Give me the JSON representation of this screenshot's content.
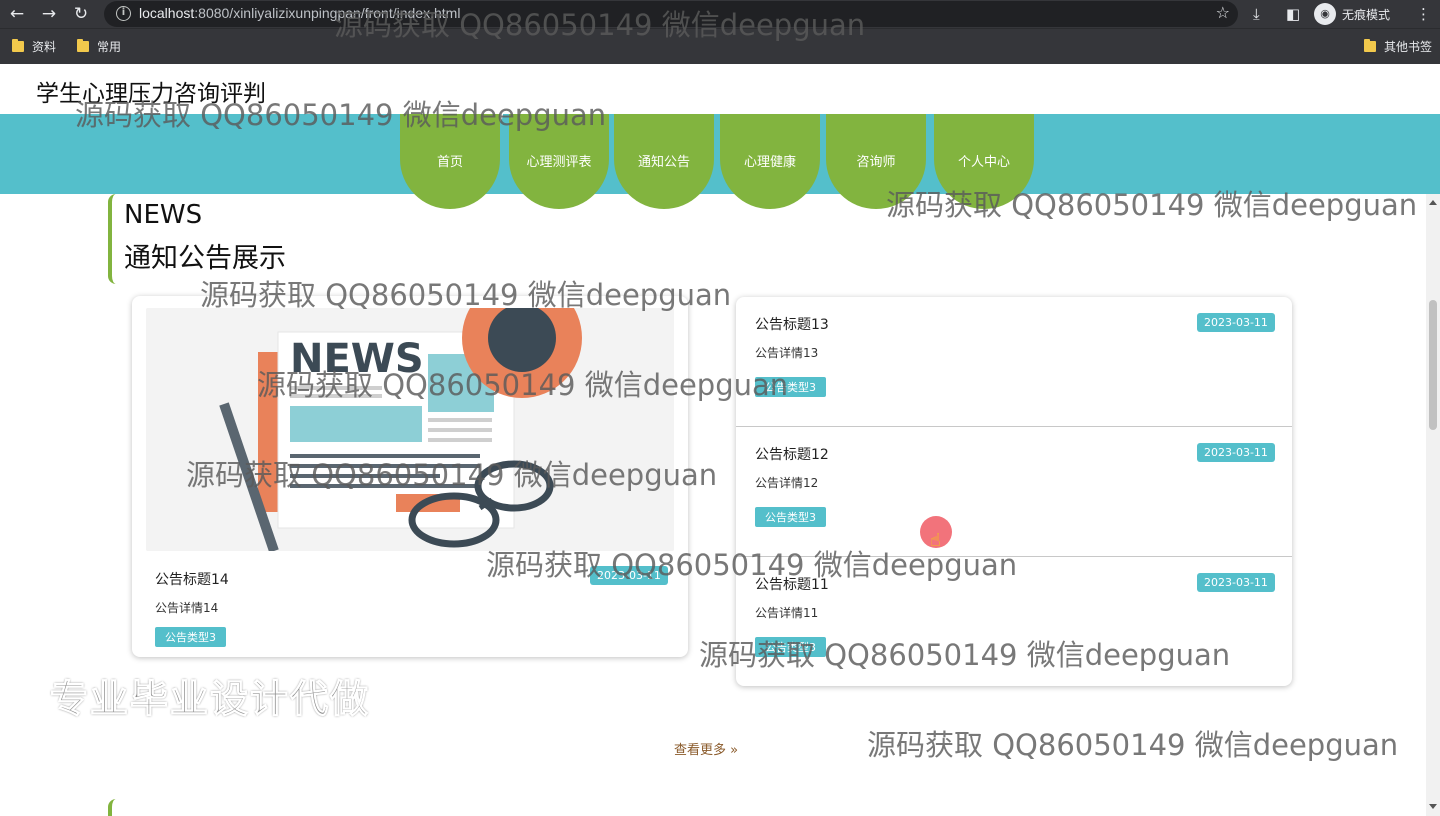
{
  "browser": {
    "url_host": "localhost",
    "url_rest": ":8080/xinliyalizixunpingpan/front/index.html",
    "incognito_label": "无痕模式",
    "bookmarks": [
      "资料",
      "常用"
    ],
    "other_bookmarks": "其他书签"
  },
  "site": {
    "title": "学生心理压力咨询评判",
    "nav": [
      "首页",
      "心理测评表",
      "通知公告",
      "心理健康",
      "咨询师",
      "个人中心"
    ]
  },
  "section": {
    "en": "NEWS",
    "cn": "通知公告展示"
  },
  "featured": {
    "image_text": "NEWS",
    "title": "公告标题14",
    "date": "2023-03-11",
    "detail": "公告详情14",
    "type": "公告类型3"
  },
  "list": [
    {
      "title": "公告标题13",
      "date": "2023-03-11",
      "detail": "公告详情13",
      "type": "公告类型3"
    },
    {
      "title": "公告标题12",
      "date": "2023-03-11",
      "detail": "公告详情12",
      "type": "公告类型3"
    },
    {
      "title": "公告标题11",
      "date": "2023-03-11",
      "detail": "公告详情11",
      "type": "公告类型3"
    }
  ],
  "more": "查看更多",
  "watermark": "源码获取 QQ86050149 微信deepguan",
  "promo": "专业毕业设计代做",
  "colors": {
    "nav_bar": "#54bfcb",
    "nav_item": "#82b43f",
    "badge": "#54bfcb"
  }
}
